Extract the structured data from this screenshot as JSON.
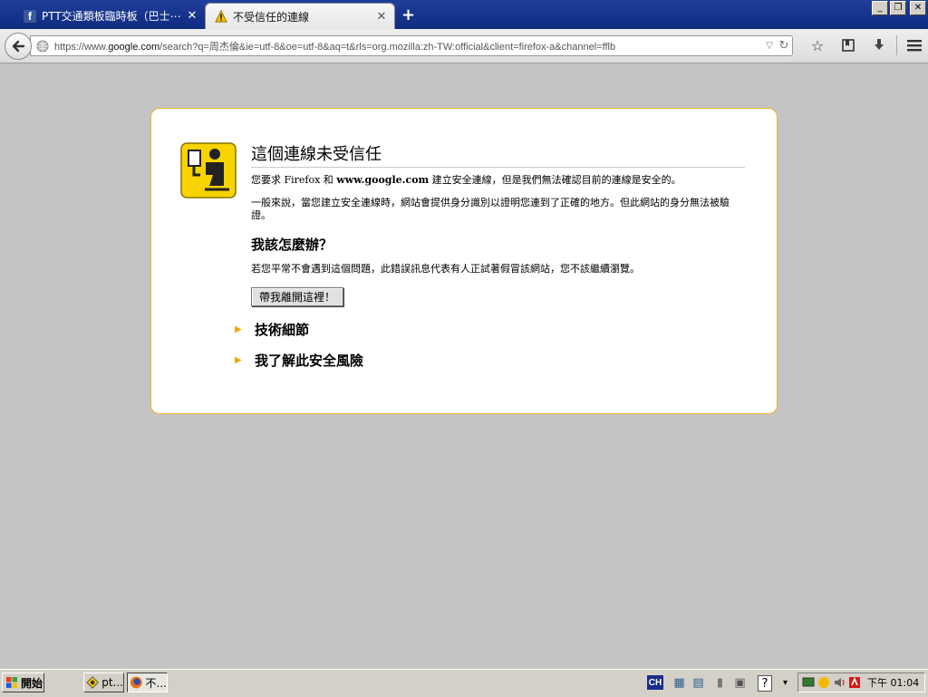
{
  "tabs": [
    {
      "title": "PTT交通類板臨時板（巴士⋯",
      "favicon": "facebook-icon"
    },
    {
      "title": "不受信任的連線",
      "favicon": "warning-icon"
    }
  ],
  "window_controls": {
    "minimize": "_",
    "restore": "❐",
    "close": "✕"
  },
  "navbar": {
    "url_prefix": "https://www.",
    "url_host": "google.com",
    "url_rest": "/search?q=周杰倫&ie=utf-8&oe=utf-8&aq=t&rls=org.mozilla:zh-TW:official&client=firefox-a&channel=fflb"
  },
  "error_page": {
    "title": "這個連線未受信任",
    "intro_before": "您要求 Firefox 和 ",
    "intro_host": "www.google.com",
    "intro_after": " 建立安全連線，但是我們無法確認目前的連線是安全的。",
    "explanation": "一般來說，當您建立安全連線時，網站會提供身分識別以證明您連到了正確的地方。但此網站的身分無法被驗證。",
    "what_to_do_title": "我該怎麼辦？",
    "what_to_do": "若您平常不會遇到這個問題，此錯誤訊息代表有人正試著假冒該網站，您不該繼續瀏覽。",
    "get_me_out": "帶我離開這裡！",
    "technical_details": "技術細節",
    "understand_risks": "我了解此安全風險"
  },
  "taskbar": {
    "start_label": "開始",
    "tasks": [
      "pt...",
      "不..."
    ],
    "ime_label": "CH",
    "clock": "下午 01:04"
  },
  "colors": {
    "tabbar": "#1f3f9a",
    "card_border": "#f0b030",
    "page_bg": "#c4c4c4",
    "expander": "#f5a800"
  }
}
